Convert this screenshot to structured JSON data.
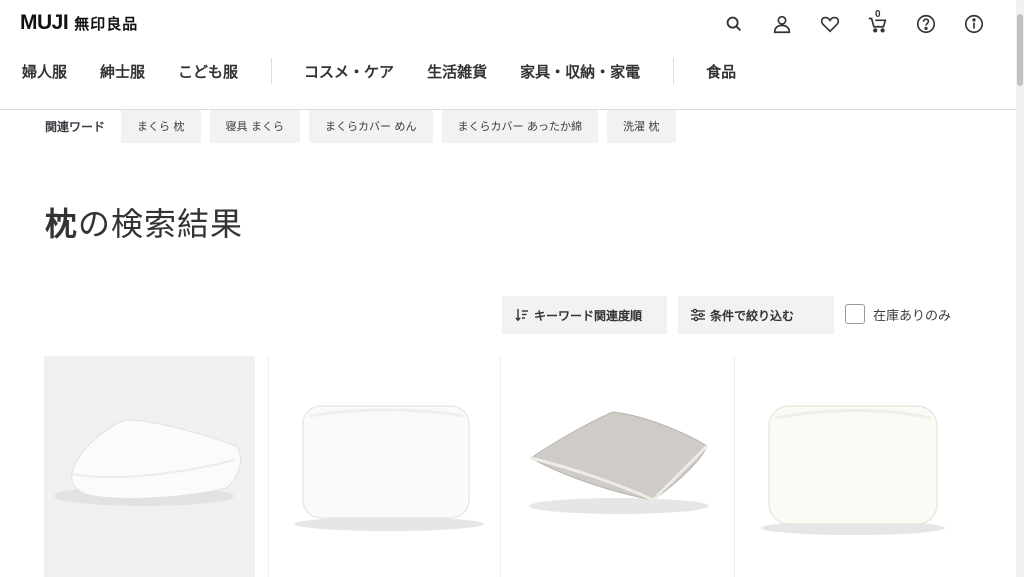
{
  "header": {
    "logo_mark": "MUJI",
    "logo_ja": "無印良品",
    "cart_count": "0",
    "icons": [
      "search-icon",
      "user-icon",
      "heart-icon",
      "cart-icon",
      "help-icon",
      "info-icon"
    ]
  },
  "nav": {
    "items": [
      "婦人服",
      "紳士服",
      "こども服",
      "コスメ・ケア",
      "生活雑貨",
      "家具・収納・家電",
      "食品"
    ]
  },
  "related": {
    "label": "関連ワード",
    "chips": [
      "まくら 枕",
      "寝具 まくら",
      "まくらカバー めん",
      "まくらカバー あったか綿",
      "洗濯 枕"
    ]
  },
  "title": {
    "keyword": "枕",
    "suffix": "の検索結果"
  },
  "controls": {
    "sort_label": "キーワード関連度順",
    "filter_label": "条件で絞り込む",
    "stock_label": "在庫ありのみ",
    "stock_checked": false
  },
  "colors": {
    "text": "#3c3c43",
    "chip_bg": "#f2f2f2",
    "divider": "#dcdcdc"
  }
}
